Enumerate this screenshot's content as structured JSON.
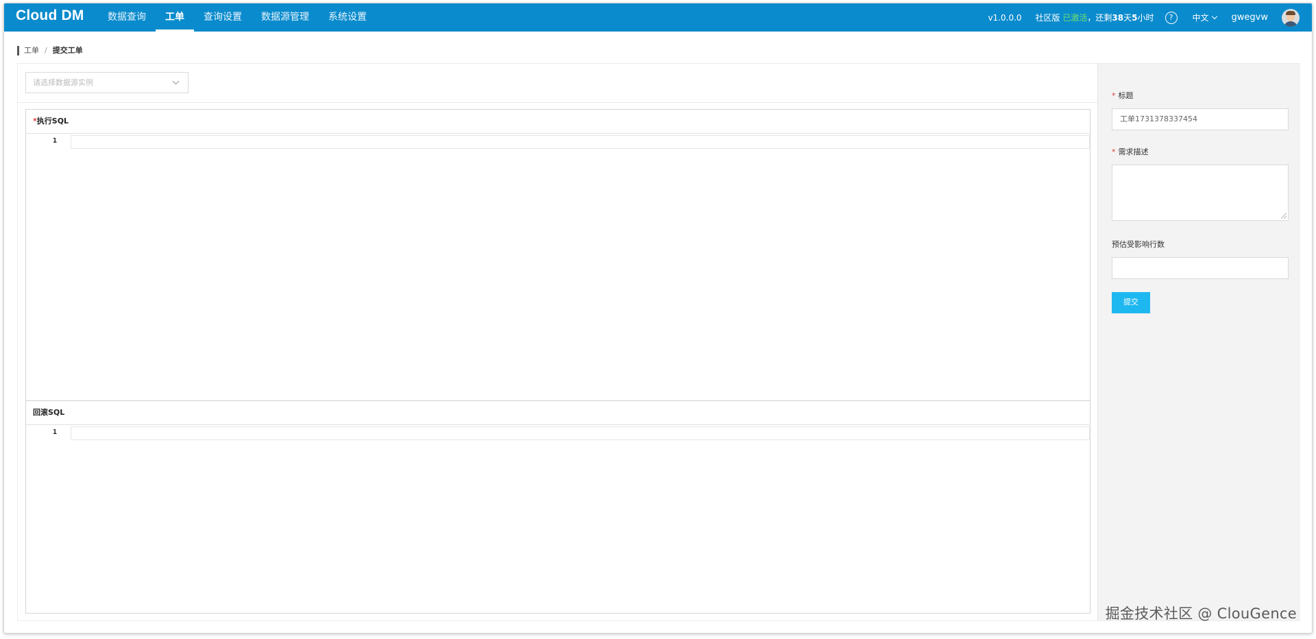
{
  "app": {
    "logo": "Cloud DM",
    "nav": [
      {
        "label": "数据查询",
        "active": false
      },
      {
        "label": "工单",
        "active": true
      },
      {
        "label": "查询设置",
        "active": false
      },
      {
        "label": "数据源管理",
        "active": false
      },
      {
        "label": "系统设置",
        "active": false
      }
    ],
    "version": "v1.0.0.0",
    "license": {
      "edition": "社区版",
      "status": "已激活",
      "remaining_prefix": "还剩",
      "days": "38",
      "days_unit": "天",
      "hours": "5",
      "hours_unit": "小时"
    },
    "help_icon": "?",
    "language": "中文",
    "username": "gwegvw"
  },
  "breadcrumb": {
    "parent": "工单",
    "separator": "/",
    "current": "提交工单"
  },
  "datasource_select": {
    "placeholder": "请选择数据源实例"
  },
  "editors": {
    "exec": {
      "required_mark": "*",
      "label": "执行SQL",
      "line_number": "1"
    },
    "rollback": {
      "label": "回滚SQL",
      "line_number": "1"
    }
  },
  "form": {
    "title_label": "标题",
    "title_value": "工单1731378337454",
    "desc_label": "需求描述",
    "desc_value": "",
    "rows_label": "预估受影响行数",
    "rows_value": "",
    "required_mark": "*",
    "submit_label": "提交"
  },
  "watermark": "掘金技术社区 @ ClouGence",
  "colors": {
    "topbar": "#0a8bcd",
    "accent_button": "#1eb8f0",
    "activated": "#6ee06e",
    "required": "#e23a3a"
  }
}
